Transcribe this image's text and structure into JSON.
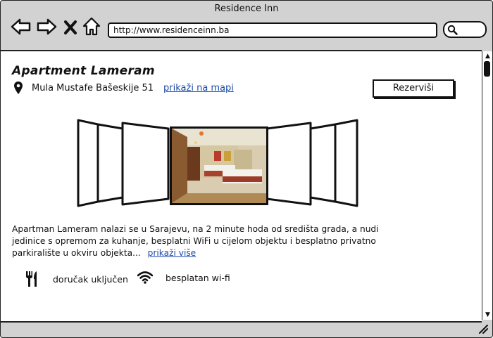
{
  "window": {
    "title": "Residence Inn"
  },
  "toolbar": {
    "url": "http://www.residenceinn.ba",
    "back_icon": "back-arrow-icon",
    "forward_icon": "forward-arrow-icon",
    "stop_icon": "close-icon",
    "home_icon": "home-icon",
    "search_icon": "search-icon"
  },
  "listing": {
    "title": "Apartment Lameram",
    "address": "Mula Mustafe Bašeskije 51",
    "map_link": "prikaži na mapi",
    "reserve_label": "Rezerviši",
    "description": "Apartman Lameram nalazi se u Sarajevu, na 2 minute hoda od središta grada, a nudi jedinice s opremom za kuhanje, besplatni WiFi u cijelom objektu i besplatno privatno parkiralište u okviru objekta...",
    "more_link": "prikaži više",
    "amenities": [
      {
        "icon": "fork-knife-icon",
        "label": "doručak uključen"
      },
      {
        "icon": "wifi-icon",
        "label": "besplatan wi-fi"
      }
    ]
  },
  "colors": {
    "link": "#1a4aa8",
    "chrome": "#d2d2d2"
  }
}
